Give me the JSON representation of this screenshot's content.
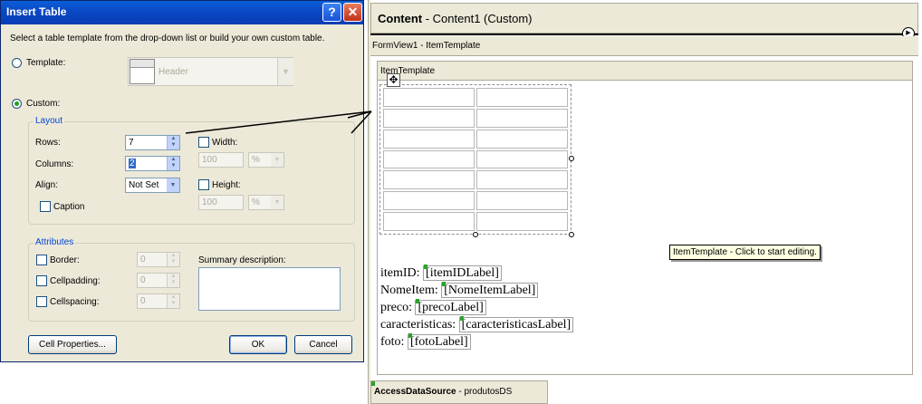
{
  "dialog": {
    "title": "Insert Table",
    "help_glyph": "?",
    "close_glyph": "✕",
    "instruction": "Select a table template from the drop-down list or build your own custom table.",
    "template_label": "Template:",
    "template_value": "Header",
    "custom_label": "Custom:",
    "selected_mode": "custom",
    "layout": {
      "group_label": "Layout",
      "rows_label": "Rows:",
      "rows_value": "7",
      "columns_label": "Columns:",
      "columns_value": "2",
      "align_label": "Align:",
      "align_value": "Not Set",
      "caption_label": "Caption",
      "width_label": "Width:",
      "width_value": "100",
      "width_unit": "%",
      "height_label": "Height:",
      "height_value": "100",
      "height_unit": "%"
    },
    "attributes": {
      "group_label": "Attributes",
      "border_label": "Border:",
      "border_value": "0",
      "cellpadding_label": "Cellpadding:",
      "cellpadding_value": "0",
      "cellspacing_label": "Cellspacing:",
      "cellspacing_value": "0",
      "summary_label": "Summary description:",
      "summary_value": ""
    },
    "buttons": {
      "cell_properties": "Cell Properties...",
      "ok": "OK",
      "cancel": "Cancel"
    }
  },
  "designer": {
    "content_label_bold": "Content",
    "content_label_rest": " - Content1 (Custom)",
    "formview_label": "FormView1 - ItemTemplate",
    "itemtemplate_label": "ItemTemplate",
    "tooltip": "ItemTemplate - Click to start editing.",
    "table": {
      "rows": 7,
      "columns": 2
    },
    "fields": [
      {
        "label": "itemID: ",
        "value": "[itemIDLabel]"
      },
      {
        "label": "NomeItem: ",
        "value": "[NomeItemLabel]"
      },
      {
        "label": "preco: ",
        "value": "[precoLabel]"
      },
      {
        "label": "caracteristicas: ",
        "value": "[caracteristicasLabel]"
      },
      {
        "label": "foto: ",
        "value": "[fotoLabel]"
      }
    ],
    "datasource_bold": "AccessDataSource",
    "datasource_rest": " - produtosDS"
  },
  "colors": {
    "titlebar": "#0b47c4",
    "dialog_bg": "#ece9d8",
    "group_label": "#0046d5",
    "tooltip_bg": "#ffffe1"
  }
}
